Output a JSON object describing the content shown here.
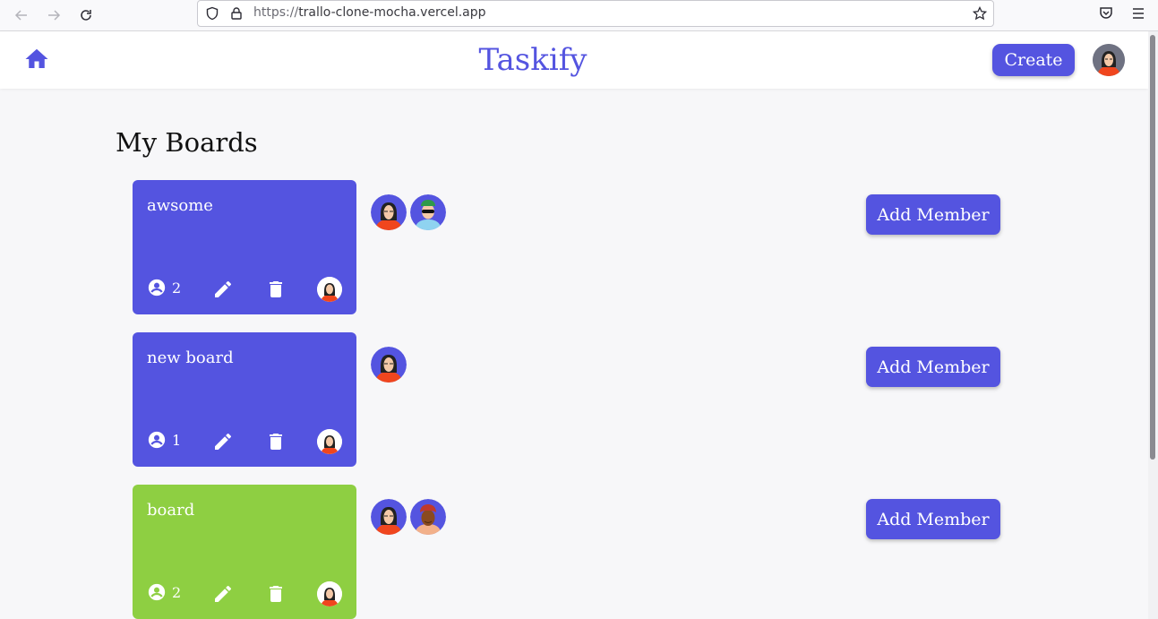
{
  "browser": {
    "url_protocol": "https://",
    "url_host": "trallo-clone-mocha.vercel.app"
  },
  "header": {
    "title": "Taskify",
    "create_label": "Create",
    "accent_color": "#5454e0"
  },
  "main": {
    "title": "My Boards",
    "add_member_label": "Add Member",
    "boards": [
      {
        "name": "awsome",
        "member_count": "2",
        "color": "#5454e0",
        "members": [
          "woman-glasses",
          "man-sunglasses"
        ]
      },
      {
        "name": "new board",
        "member_count": "1",
        "color": "#5454e0",
        "members": [
          "woman-glasses"
        ]
      },
      {
        "name": "board",
        "member_count": "2",
        "color": "#8ecf42",
        "members": [
          "woman-glasses",
          "woman-headwrap"
        ]
      }
    ]
  }
}
